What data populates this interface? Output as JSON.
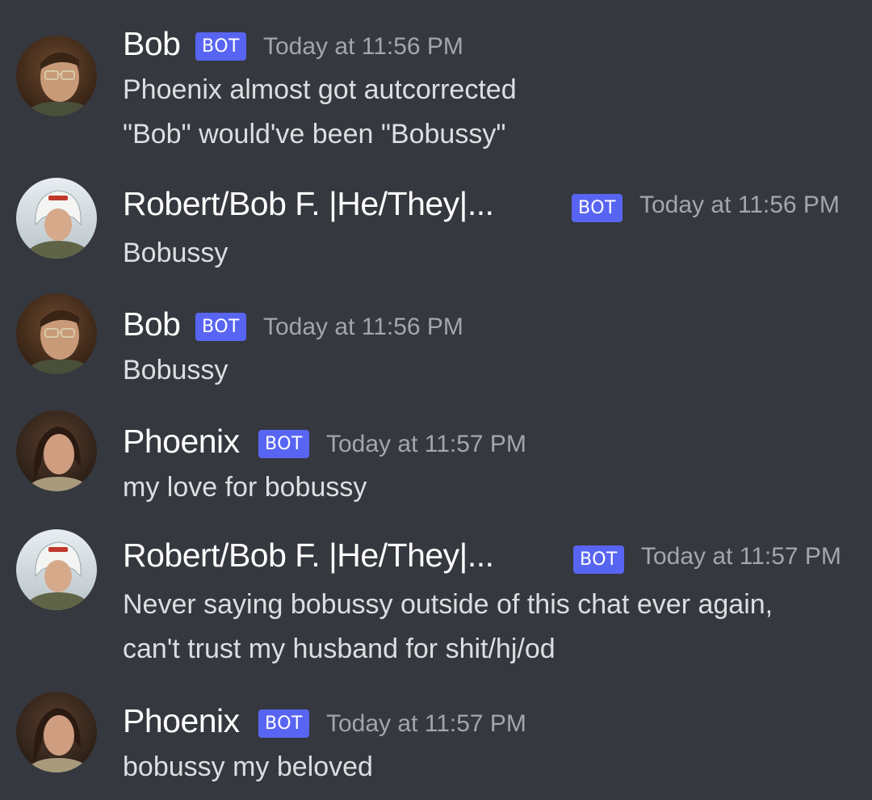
{
  "colors": {
    "background": "#36383f",
    "username": "#ffffff",
    "message_text": "#dcdee1",
    "timestamp": "#a3a6aa",
    "bot_badge": "#5865f2"
  },
  "messages": [
    {
      "author": "Bob",
      "avatar_icon": "bob-avatar-icon",
      "badge": "BOT",
      "timestamp": "Today at 11:56 PM",
      "lines": [
        "Phoenix almost got autcorrected",
        "\"Bob\" would've been \"Bobussy\""
      ]
    },
    {
      "author": "Robert/Bob F. |He/They|...",
      "avatar_icon": "robert-avatar-icon",
      "badge": "BOT",
      "timestamp": "Today at 11:56 PM",
      "lines": [
        "Bobussy"
      ]
    },
    {
      "author": "Bob",
      "avatar_icon": "bob-avatar-icon",
      "badge": "BOT",
      "timestamp": "Today at 11:56 PM",
      "lines": [
        "Bobussy"
      ]
    },
    {
      "author": "Phoenix",
      "avatar_icon": "phoenix-avatar-icon",
      "badge": "BOT",
      "timestamp": "Today at 11:57 PM",
      "lines": [
        "my love for bobussy"
      ]
    },
    {
      "author": "Robert/Bob F. |He/They|...",
      "avatar_icon": "robert-avatar-icon",
      "badge": "BOT",
      "timestamp": "Today at 11:57 PM",
      "lines": [
        "Never saying bobussy outside of this chat ever again,",
        "can't trust my husband for shit/hj/od"
      ]
    },
    {
      "author": "Phoenix",
      "avatar_icon": "phoenix-avatar-icon",
      "badge": "BOT",
      "timestamp": "Today at 11:57 PM",
      "lines": [
        "bobussy my beloved"
      ]
    }
  ]
}
